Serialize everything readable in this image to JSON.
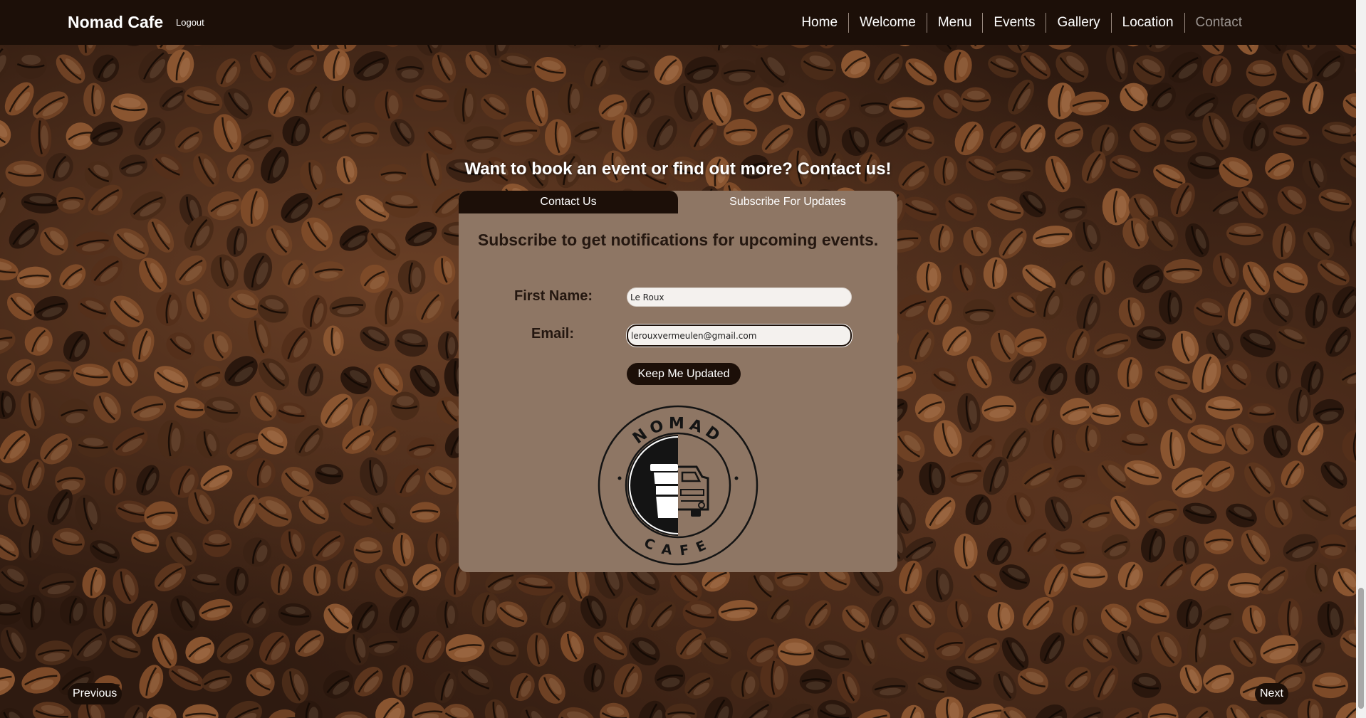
{
  "navbar": {
    "brand": "Nomad Cafe",
    "logout": "Logout",
    "links": [
      {
        "label": "Home"
      },
      {
        "label": "Welcome"
      },
      {
        "label": "Menu"
      },
      {
        "label": "Events"
      },
      {
        "label": "Gallery"
      },
      {
        "label": "Location"
      },
      {
        "label": "Contact"
      }
    ]
  },
  "headline": "Want to book an event or find out more? Contact us!",
  "card": {
    "tabs": [
      {
        "label": "Contact Us"
      },
      {
        "label": "Subscribe For Updates"
      }
    ],
    "active_tab": "Subscribe For Updates",
    "heading": "Subscribe to get notifications for upcoming events.",
    "form": {
      "first_name_label": "First Name:",
      "first_name_value": "Le Roux",
      "email_label": "Email:",
      "email_value": "lerouxvermeulen@gmail.com",
      "submit_label": "Keep Me Updated"
    },
    "logo": {
      "top_text": "NOMAD",
      "bottom_text": "CAFE"
    }
  },
  "pager": {
    "previous": "Previous",
    "next": "Next"
  },
  "colors": {
    "nav_bg": "#1c0f08",
    "card_bg": "#8e7664",
    "button_bg": "#1c0f08",
    "text_dark": "#241710",
    "inactive_link": "#9b9490"
  }
}
